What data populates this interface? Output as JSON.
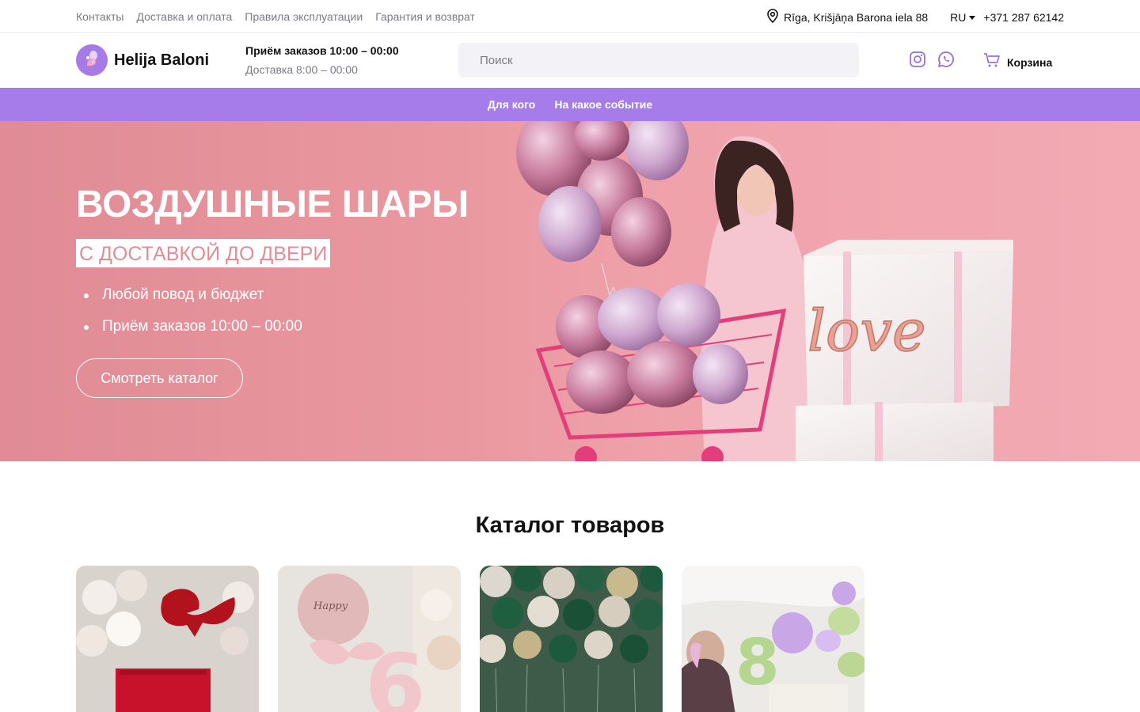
{
  "topbar": {
    "links": [
      "Контакты",
      "Доставка и оплата",
      "Правила эксплуатации",
      "Гарантия и возврат"
    ],
    "address": "Rīga, Krišjāņa Barona iela 88",
    "language": "RU",
    "phone": "+371 287 62142"
  },
  "header": {
    "logo_text": "Helija Baloni",
    "hours_orders": "Приём заказов 10:00 – 00:00",
    "hours_delivery": "Доставка 8:00 – 00:00",
    "search_placeholder": "Поиск",
    "cart_label": "Корзина",
    "social_icons": [
      "instagram-icon",
      "whatsapp-icon"
    ]
  },
  "nav": {
    "items": [
      "Для кого",
      "На какое событие"
    ]
  },
  "hero": {
    "title": "ВОЗДУШНЫЕ ШАРЫ",
    "subtitle": "С ДОСТАВКОЙ ДО ДВЕРИ",
    "bullets": [
      "Любой повод и бюджет",
      "Приём заказов 10:00 – 00:00"
    ],
    "button_label": "Смотреть каталог"
  },
  "catalog": {
    "title": "Каталог товаров"
  },
  "colors": {
    "accent_purple": "#a67ceb",
    "hero_pink": "#ea98a0",
    "subtitle_text": "#e18c97"
  }
}
